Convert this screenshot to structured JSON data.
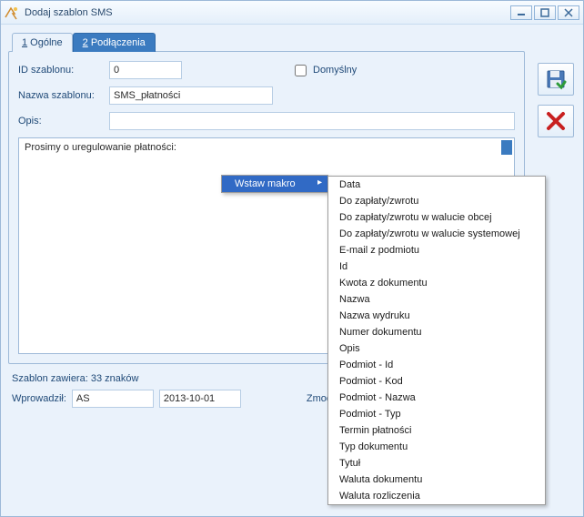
{
  "window": {
    "title": "Dodaj szablon SMS"
  },
  "tabs": {
    "general": "1 Ogólne",
    "connections": "2 Podłączenia",
    "g_underline": "1",
    "g_rest": " Ogólne",
    "c_underline": "2",
    "c_rest": " Podłączenia"
  },
  "labels": {
    "id": "ID szablonu:",
    "name": "Nazwa szablonu:",
    "desc": "Opis:",
    "default": "Domyślny"
  },
  "fields": {
    "id_value": "0",
    "name_value": "SMS_płatności",
    "desc_value": "",
    "body_value": "Prosimy o uregulowanie płatności:"
  },
  "status": {
    "count_label": "Szablon zawiera: 33 znaków"
  },
  "footer": {
    "created_label": "Wprowadził:",
    "created_user": "AS",
    "created_date": "2013-10-01",
    "modified_label": "Zmod"
  },
  "context": {
    "trigger": "Wstaw makro",
    "items": [
      "Data",
      "Do zapłaty/zwrotu",
      "Do zapłaty/zwrotu w walucie obcej",
      "Do zapłaty/zwrotu w walucie systemowej",
      "E-mail z podmiotu",
      "Id",
      "Kwota z dokumentu",
      "Nazwa",
      "Nazwa wydruku",
      "Numer dokumentu",
      "Opis",
      "Podmiot - Id",
      "Podmiot - Kod",
      "Podmiot - Nazwa",
      "Podmiot - Typ",
      "Termin płatności",
      "Typ dokumentu",
      "Tytuł",
      "Waluta dokumentu",
      "Waluta rozliczenia"
    ]
  }
}
